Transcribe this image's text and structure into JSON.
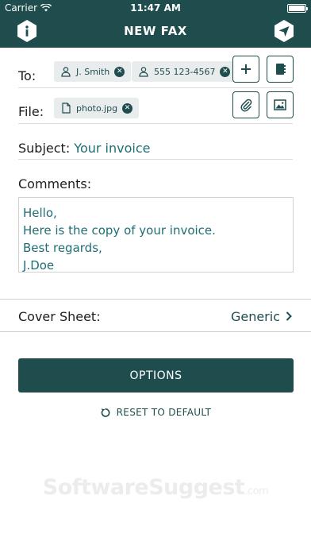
{
  "status": {
    "carrier": "Carrier",
    "time": "11:47 AM"
  },
  "header": {
    "title": "NEW FAX"
  },
  "to": {
    "label": "To:",
    "recipients": [
      {
        "name": "J. Smith"
      },
      {
        "name": "555 123-4567"
      }
    ]
  },
  "file": {
    "label": "File:",
    "attachment": "photo.jpg"
  },
  "subject": {
    "label": "Subject:",
    "value": "Your invoice"
  },
  "comments": {
    "label": "Comments:",
    "lines": [
      "Hello,",
      "Here is the copy of your invoice.",
      "Best regards,",
      "J.Doe"
    ]
  },
  "cover": {
    "label": "Cover Sheet:",
    "value": "Generic"
  },
  "actions": {
    "options": "OPTIONS",
    "reset": "RESET TO DEFAULT"
  },
  "watermark": {
    "brand": "SoftwareSuggest",
    "suffix": ".com"
  },
  "colors": {
    "primary": "#1f4d4e",
    "accent_text": "#1f6e75",
    "chip_bg": "#e9ecec"
  }
}
